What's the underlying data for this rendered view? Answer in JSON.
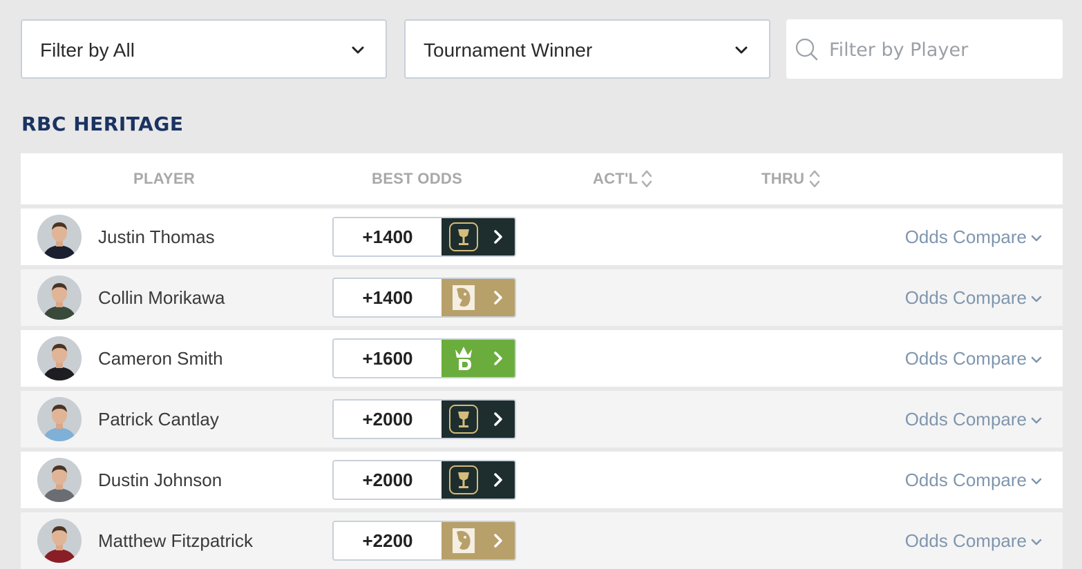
{
  "filters": {
    "category": {
      "value": "Filter by All"
    },
    "market": {
      "value": "Tournament Winner"
    },
    "search": {
      "placeholder": "Filter by Player"
    }
  },
  "event": {
    "title": "RBC HERITAGE"
  },
  "table": {
    "headers": {
      "player": "PLAYER",
      "best_odds": "BEST ODDS",
      "actual": "ACT'L",
      "thru": "THRU"
    },
    "compare_label": "Odds Compare",
    "rows": [
      {
        "player": "Justin Thomas",
        "odds": "+1400",
        "book": "trophy",
        "book_color": "#1e2e2e",
        "shirt": "#1a2030"
      },
      {
        "player": "Collin Morikawa",
        "odds": "+1400",
        "book": "lion",
        "book_color": "#b8a06a",
        "shirt": "#3a4a3a"
      },
      {
        "player": "Cameron Smith",
        "odds": "+1600",
        "book": "crown",
        "book_color": "#6aad3c",
        "shirt": "#1e1e22"
      },
      {
        "player": "Patrick Cantlay",
        "odds": "+2000",
        "book": "trophy",
        "book_color": "#1e2e2e",
        "shirt": "#7fb0d8"
      },
      {
        "player": "Dustin Johnson",
        "odds": "+2000",
        "book": "trophy",
        "book_color": "#1e2e2e",
        "shirt": "#6a6e72"
      },
      {
        "player": "Matthew Fitzpatrick",
        "odds": "+2200",
        "book": "lion",
        "book_color": "#b8a06a",
        "shirt": "#8a1e26"
      }
    ]
  }
}
